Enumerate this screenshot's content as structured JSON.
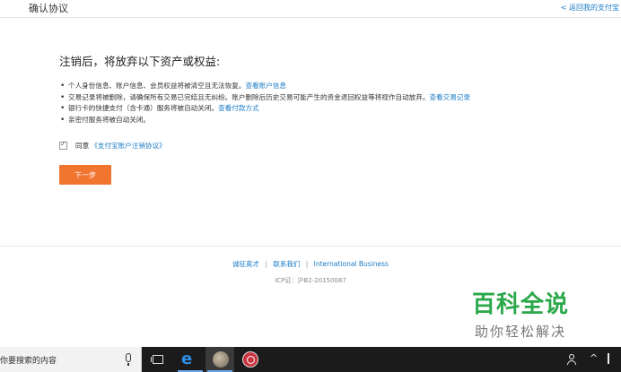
{
  "header": {
    "title": "确认协议",
    "back_link": "< 返回我的支付宝"
  },
  "main": {
    "heading": "注销后，将放弃以下资产或权益:",
    "bullets": [
      {
        "text": "个人身份信息、账户信息、会员权益将被清空且无法恢复。",
        "link": "查看账户信息"
      },
      {
        "text": "交易记录将被删除，请确保所有交易已完结且无纠纷。账户删除后历史交易可能产生的资金退回权益等将视作自动放弃。",
        "link": "查看交易记录"
      },
      {
        "text": "银行卡的快捷支付（含卡通）服务将被自动关闭。",
        "link": "查看付款方式"
      },
      {
        "text": "亲密付服务将被自动关闭。",
        "link": ""
      }
    ],
    "agree": {
      "label": "同意",
      "link": "《支付宝账户注销协议》"
    },
    "next_button": "下一步"
  },
  "footer": {
    "links": [
      "诚征英才",
      "联系我们",
      "International Business"
    ],
    "separator": "|",
    "icp": "ICP证：沪B2-20150087"
  },
  "watermark": {
    "main": "百科全说",
    "sub": "助你轻松解决"
  },
  "taskbar": {
    "search_placeholder": "你要搜索的内容",
    "edge_glyph": "e"
  },
  "colors": {
    "link": "#1a7bc6",
    "button": "#f1742f",
    "watermark_green": "#2aa84a",
    "taskbar": "#1b1b1b"
  },
  "icons": [
    "checkbox-checked-icon",
    "microphone-icon",
    "task-view-icon",
    "edge-icon",
    "people-icon",
    "chevron-up-icon",
    "network-icon"
  ]
}
